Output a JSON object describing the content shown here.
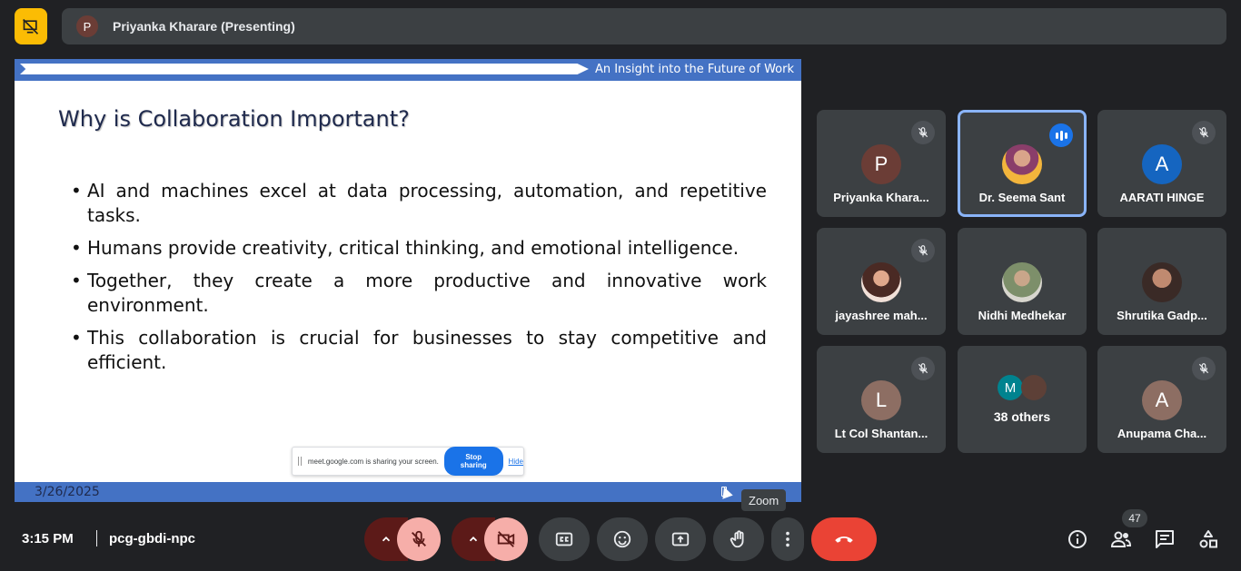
{
  "top_bar": {
    "presenter_initial": "P",
    "presenter_label": "Priyanka Kharare (Presenting)"
  },
  "slide": {
    "header_text": "An Insight into the Future of Work",
    "title": "Why is Collaboration Important?",
    "bullets": [
      "AI and machines excel at data processing, automation, and repetitive tasks.",
      "Humans provide creativity, critical thinking, and emotional intelligence.",
      "Together, they create a more productive and innovative work environment.",
      "This collaboration is crucial for businesses to stay competitive and efficient."
    ],
    "date": "3/26/2025",
    "share_notice": {
      "text": "meet.google.com is sharing your screen.",
      "stop_label": "Stop sharing",
      "hide_label": "Hide"
    }
  },
  "tooltip": "Zoom",
  "participants": [
    {
      "name": "Priyanka Khara...",
      "initial": "P",
      "color": "#6b3d36",
      "muted": true
    },
    {
      "name": "Dr. Seema Sant",
      "initial": "",
      "color": "",
      "muted": false,
      "speaking": true
    },
    {
      "name": "AARATI HINGE",
      "initial": "A",
      "color": "#1565c0",
      "muted": true
    },
    {
      "name": "jayashree mah...",
      "initial": "",
      "color": "",
      "muted": true
    },
    {
      "name": "Nidhi Medhekar",
      "initial": "",
      "color": "",
      "muted": false
    },
    {
      "name": "Shrutika Gadp...",
      "initial": "",
      "color": "",
      "muted": false
    },
    {
      "name": "Lt Col Shantan...",
      "initial": "L",
      "color": "#8d6e63",
      "muted": true
    },
    {
      "name": "Anupama Cha...",
      "initial": "A",
      "color": "#8d6e63",
      "muted": true
    }
  ],
  "others": {
    "label": "38 others",
    "initial": "M",
    "color": "#00838f"
  },
  "bottom_bar": {
    "time": "3:15 PM",
    "meeting_code": "pcg-gbdi-npc",
    "participant_count": "47"
  },
  "colors": {
    "accent": "#8ab4f8",
    "end_call": "#ea4335",
    "mic_off_bg": "#f6aea9",
    "present_off": "#fbbc04"
  }
}
